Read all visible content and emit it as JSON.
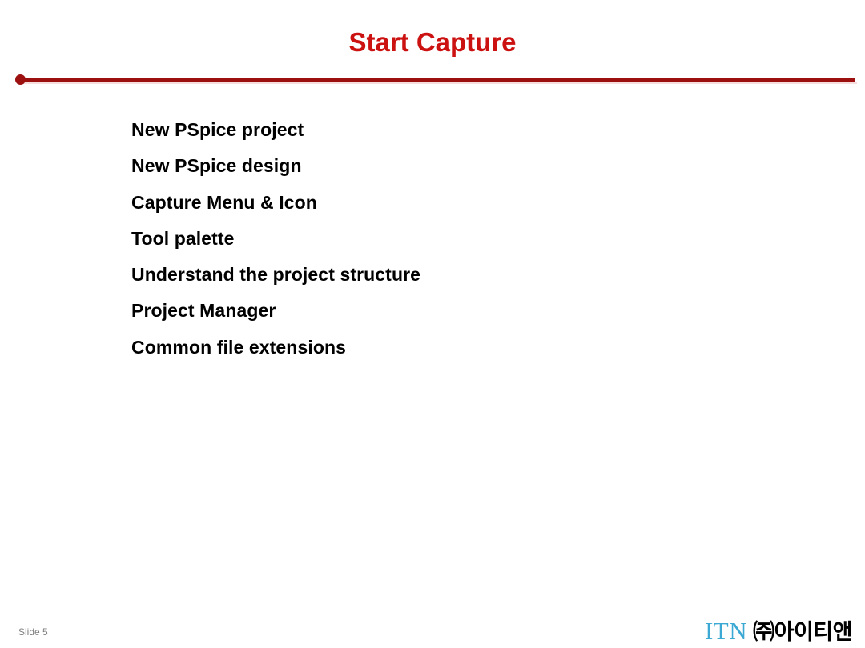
{
  "slide": {
    "title": "Start Capture",
    "title_color": "#cc1111",
    "divider_color": "#9c1010",
    "background_color": "#ffffff"
  },
  "body": {
    "items": [
      {
        "label": "New PSpice project"
      },
      {
        "label": "New PSpice design"
      },
      {
        "label": "Capture Menu & Icon"
      },
      {
        "label": "Tool palette"
      },
      {
        "label": "Understand the project structure"
      },
      {
        "label": "Project Manager"
      },
      {
        "label": "Common file extensions"
      }
    ]
  },
  "footer": {
    "slide_number": "Slide 5",
    "logo_primary": "ITN",
    "logo_primary_color": "#3ba9d4",
    "logo_secondary": "㈜아이티앤",
    "logo_secondary_color": "#000000"
  }
}
